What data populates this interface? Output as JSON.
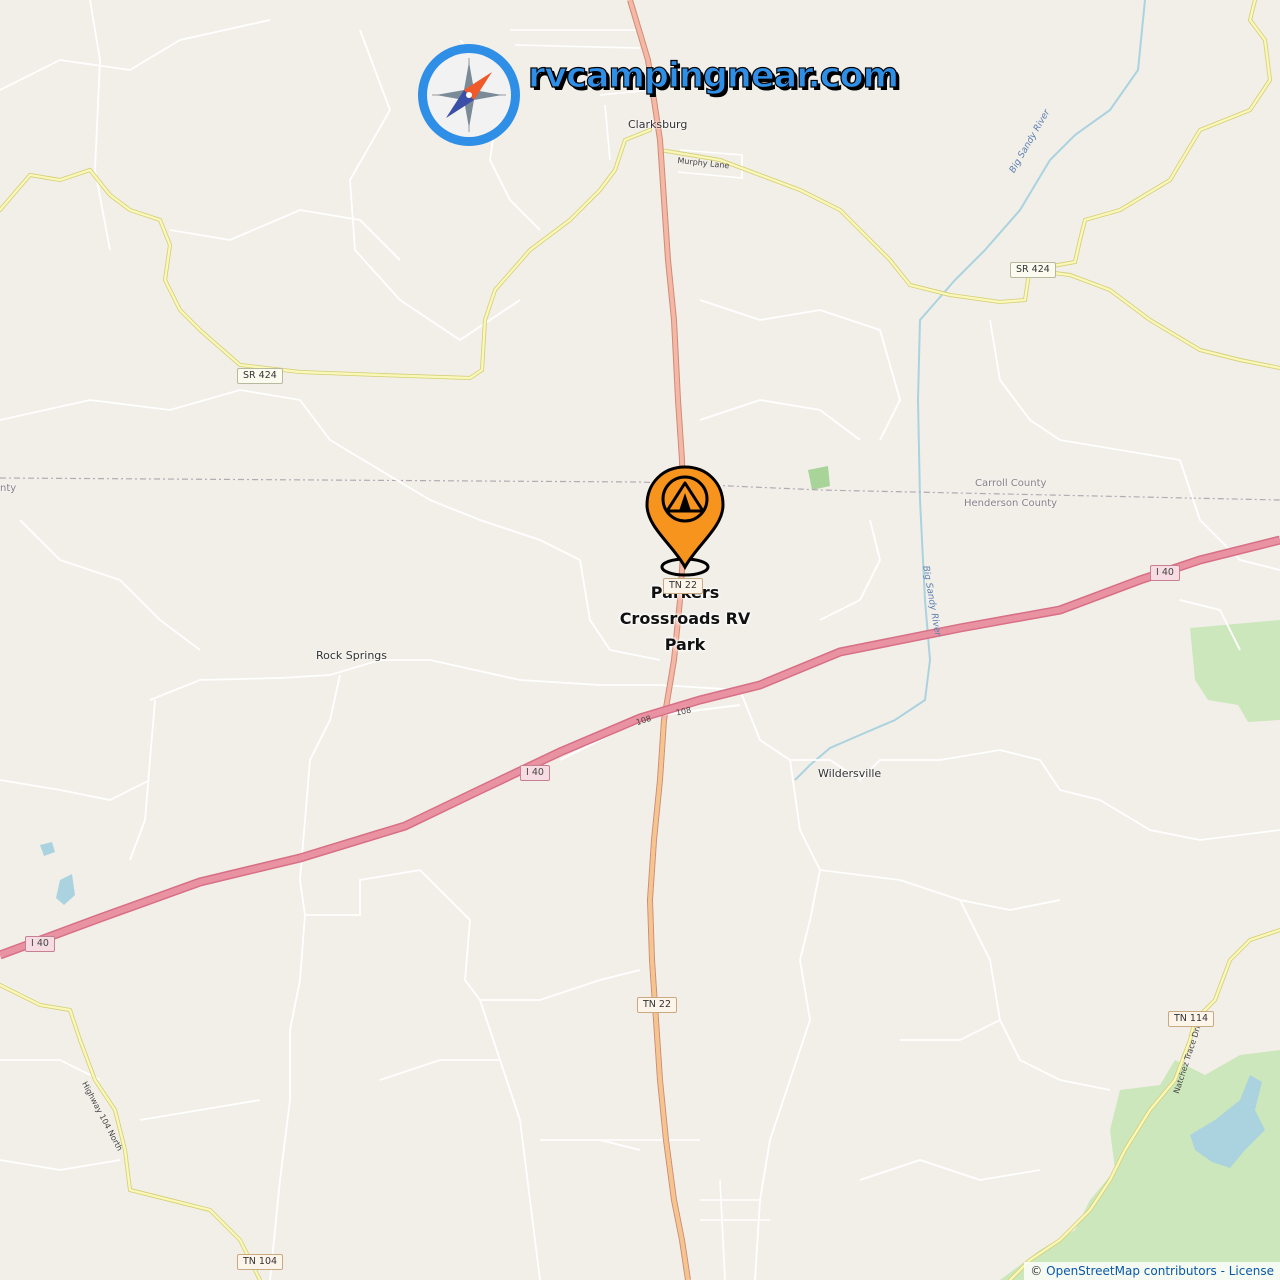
{
  "brand": {
    "site_name": "rvcampingnear.com",
    "logo_icon": "compass-icon",
    "accent": "#2f8ee6"
  },
  "marker": {
    "icon": "campsite-pin-icon",
    "color": "#f7941d",
    "label_lines": [
      "Parkers",
      "Crossroads RV",
      "Park"
    ]
  },
  "places": {
    "clarksburg": "Clarksburg",
    "rock_springs": "Rock Springs",
    "wildersville": "Wildersville",
    "carroll_county": "Carroll County",
    "henderson_county": "Henderson County",
    "county_west_fragment": "nty"
  },
  "rivers": {
    "big_sandy_north": "Big Sandy River",
    "big_sandy_south": "Big Sandy River"
  },
  "roads": {
    "murphy_lane": "Murphy Lane",
    "highway_104_north": "Highway 104 North",
    "natchez_trace_drive": "Natchez Trace Drive",
    "route_108_a": "108",
    "route_108_b": "108"
  },
  "shields": {
    "sr424_west": "SR 424",
    "sr424_east": "SR 424",
    "tn22_top": "TN 22",
    "tn22": "TN 22",
    "tn114": "TN 114",
    "tn104": "TN 104",
    "i40_east": "I 40",
    "i40_mid": "I 40",
    "i40_west": "I 40"
  },
  "attribution": {
    "copyright": "©",
    "osm": "OpenStreetMap contributors",
    "separator": "-",
    "license": "License"
  },
  "colors": {
    "land": "#f2efe9",
    "interstate": "#e892a2",
    "trunk": "#f3a596",
    "secondary": "#f7e08a",
    "water": "#aad3df",
    "forest": "#c8e6b7"
  }
}
